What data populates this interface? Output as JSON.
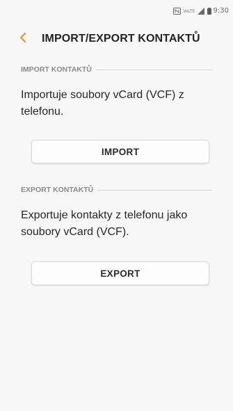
{
  "status_bar": {
    "time": "9:30",
    "icons": [
      "nfc-icon",
      "volte-icon",
      "signal-icon",
      "battery-icon"
    ],
    "volte_label": "VoLTE"
  },
  "header": {
    "title": "IMPORT/EXPORT KONTAKTŮ",
    "back_icon": "chevron-left-icon",
    "accent_color": "#f08a24"
  },
  "import_section": {
    "label": "IMPORT KONTAKTŮ",
    "description": "Importuje soubory vCard (VCF) z telefonu.",
    "button_label": "IMPORT"
  },
  "export_section": {
    "label": "EXPORT KONTAKTŮ",
    "description": "Exportuje kontakty z telefonu jako soubory vCard (VCF).",
    "button_label": "EXPORT"
  }
}
